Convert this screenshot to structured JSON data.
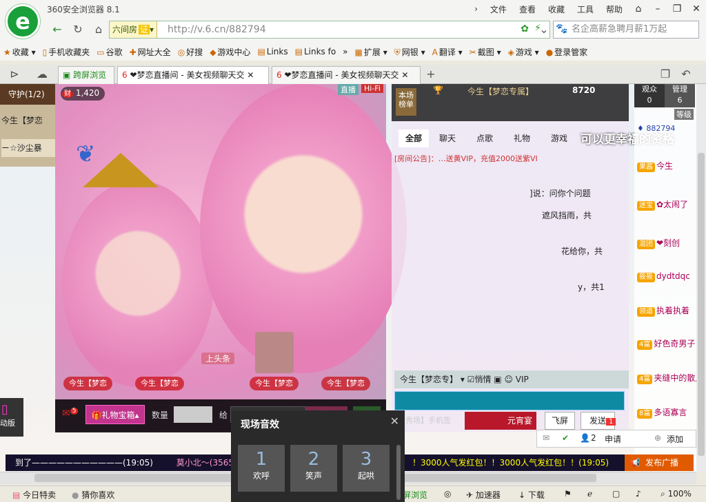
{
  "browser": {
    "title": "360安全浏览器 8.1",
    "logo_letter": "e",
    "menu": [
      "文件",
      "查看",
      "收藏",
      "工具",
      "帮助"
    ],
    "address_tag": "六间房",
    "address_cert": "证",
    "url": "http://v.6.cn/882794",
    "search_text": "名企高薪急聘月薪1万起"
  },
  "bookmarks": [
    "收藏",
    "手机收藏夹",
    "谷歌",
    "网址大全",
    "好搜",
    "游戏中心",
    "Links",
    "Links fo",
    "扩展",
    "网银",
    "翻译",
    "截图",
    "游戏",
    "登录管家"
  ],
  "tabs": {
    "split_view": "跨屏浏览",
    "tab1": "❤梦恋直播间 - 美女视频聊天交",
    "tab2": "❤梦恋直播间 - 美女视频聊天交"
  },
  "room": {
    "guard_label": "守护(1/2)",
    "guards": [
      "今生【梦恋",
      "ㄧ☆沙尘暴"
    ],
    "wealth": "1,420",
    "live_badge": "直播",
    "hifi_badge": "Hi-Fi",
    "stage_label": "本场榜单",
    "top_user": "今生【梦恋专属】",
    "top_score": "8720",
    "seats": [
      "今生【梦恋",
      "今生【梦恋",
      "今生【梦恋",
      "今生【梦恋"
    ],
    "rank_badge": "上头条",
    "gift_box": "礼物宝箱",
    "qty_label": "数量",
    "give_label": "给",
    "send_gift": "赠送",
    "recharge": "充值",
    "mobile_label": "动版"
  },
  "chat": {
    "tabs": [
      "全部",
      "聊天",
      "点歌",
      "礼物",
      "游戏"
    ],
    "headline": "可以更幸福的资格",
    "notice": "[房间公告]：…送黄VIP，充值2000送紫VI",
    "lines": [
      "]说：问你个问题",
      "遮风挡雨，共",
      "花给你，共",
      "y，共1"
    ],
    "input_target": "今生【梦恋专】",
    "whisper": "悄情",
    "vip": "VIP",
    "flyscreen": "飞屏",
    "send": "发送",
    "send_badge": "1",
    "yuanxiao": "元宵宴",
    "xiuchang": "秀场】手机签"
  },
  "users": {
    "tabs": [
      "观众",
      "管理"
    ],
    "counts": [
      "0",
      "6"
    ],
    "level_tab": "等级",
    "room_id": "882794",
    "list": [
      {
        "badge": "果酱",
        "name": "今生"
      },
      {
        "badge": "迷宝",
        "name": "✿太闹了"
      },
      {
        "badge": "混团",
        "name": "❤刻创"
      },
      {
        "badge": "筱筱",
        "name": "dydtdqc"
      },
      {
        "badge": "领道",
        "name": "执着执着"
      },
      {
        "badge": "4富",
        "name": "好色奇男子"
      },
      {
        "badge": "4富",
        "name": "夹缝中的散户"
      },
      {
        "badge": "8富",
        "name": "多语寡言"
      }
    ]
  },
  "chip": {
    "count": "2",
    "apply": "申请",
    "add": "添加"
  },
  "effects": {
    "title": "现场音效",
    "items": [
      {
        "num": "1",
        "label": "欢呼"
      },
      {
        "num": "2",
        "label": "笑声"
      },
      {
        "num": "3",
        "label": "起哄"
      }
    ]
  },
  "ticker": {
    "start": "到了———————————(19:05)",
    "mid": "莫小北～(3565746",
    "end": "！3000人气发红包！！3000人气发红包！！(19:05)",
    "broadcast": "发布广播"
  },
  "status": {
    "left": [
      "今日特卖",
      "猜你喜欢"
    ],
    "split": "屏浏览",
    "accel": "加速器",
    "download": "下载",
    "zoom": "100%"
  },
  "colors": {
    "accent": "#19a03a",
    "tab_icon": "#e0281b"
  }
}
